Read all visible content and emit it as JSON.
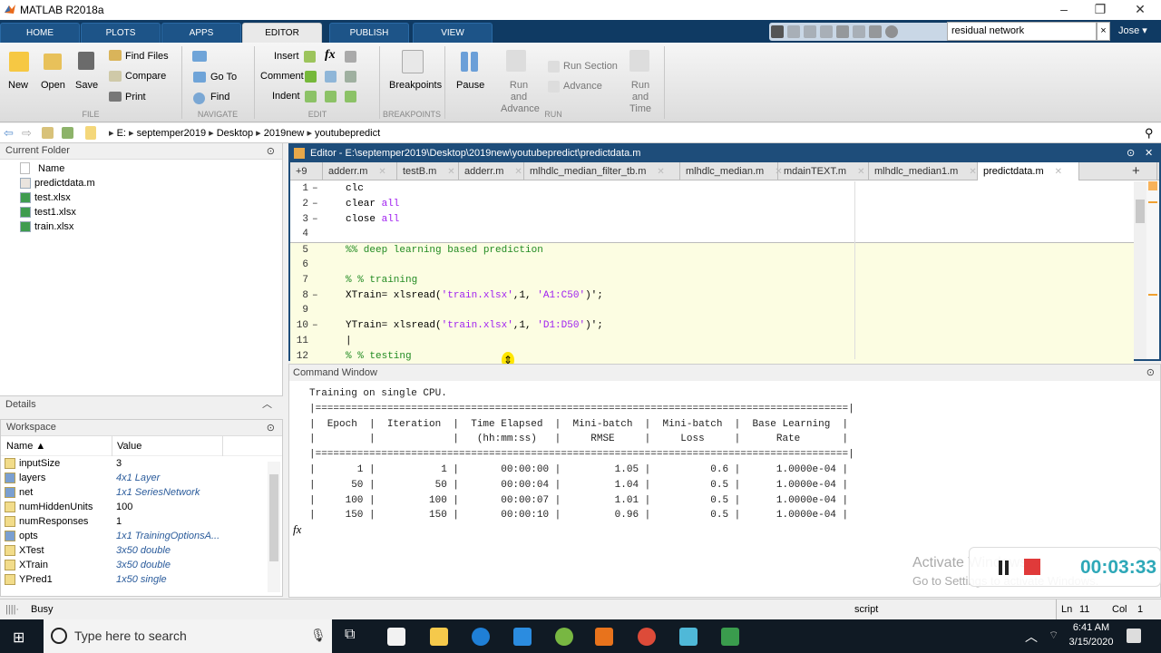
{
  "window": {
    "title": "MATLAB R2018a"
  },
  "ribbon_tabs": [
    "HOME",
    "PLOTS",
    "APPS",
    "EDITOR",
    "PUBLISH",
    "VIEW"
  ],
  "active_tab": "EDITOR",
  "search": {
    "value": "residual network",
    "clear": "×"
  },
  "user": "Jose ▾",
  "ribbon": {
    "file": {
      "new": "New",
      "open": "Open",
      "save": "Save",
      "find_files": "Find Files",
      "compare": "Compare",
      "print": "Print",
      "section": "FILE"
    },
    "navigate": {
      "goto": "Go To",
      "find": "Find",
      "section": "NAVIGATE"
    },
    "edit": {
      "insert": "Insert",
      "comment": "Comment",
      "indent": "Indent",
      "fx": "fx",
      "section": "EDIT"
    },
    "breakpoints": {
      "label": "Breakpoints",
      "section": "BREAKPOINTS"
    },
    "run": {
      "pause": "Pause",
      "run_advance": "Run and Advance",
      "run_section": "Run Section",
      "advance": "Advance",
      "run_time": "Run and Time",
      "section": "RUN"
    }
  },
  "address": {
    "segments": [
      "E:",
      "septemper2019",
      "Desktop",
      "2019new",
      "youtubepredict"
    ]
  },
  "current_folder": {
    "title": "Current Folder",
    "column": "Name",
    "files": [
      {
        "name": "predictdata.m",
        "type": "m"
      },
      {
        "name": "test.xlsx",
        "type": "xlsx"
      },
      {
        "name": "test1.xlsx",
        "type": "xlsx"
      },
      {
        "name": "train.xlsx",
        "type": "xlsx"
      }
    ]
  },
  "details": {
    "title": "Details"
  },
  "workspace": {
    "title": "Workspace",
    "columns": [
      "Name ▲",
      "Value"
    ],
    "vars": [
      {
        "name": "inputSize",
        "value": "3",
        "kind": "num"
      },
      {
        "name": "layers",
        "value": "4x1 Layer",
        "kind": "obj"
      },
      {
        "name": "net",
        "value": "1x1 SeriesNetwork",
        "kind": "obj"
      },
      {
        "name": "numHiddenUnits",
        "value": "100",
        "kind": "num"
      },
      {
        "name": "numResponses",
        "value": "1",
        "kind": "num"
      },
      {
        "name": "opts",
        "value": "1x1 TrainingOptionsA...",
        "kind": "obj"
      },
      {
        "name": "XTest",
        "value": "3x50 double",
        "kind": "arr"
      },
      {
        "name": "XTrain",
        "value": "3x50 double",
        "kind": "arr"
      },
      {
        "name": "YPred1",
        "value": "1x50 single",
        "kind": "arr"
      }
    ]
  },
  "editor": {
    "title": "Editor - E:\\septemper2019\\Desktop\\2019new\\youtubepredict\\predictdata.m",
    "overflow": "+9",
    "tabs": [
      "adderr.m",
      "testB.m",
      "adderr.m",
      "mlhdlc_median_filter_tb.m",
      "mlhdlc_median.m",
      "mdainTEXT.m",
      "mlhdlc_median1.m",
      "predictdata.m"
    ],
    "active_tab": "predictdata.m",
    "lines": [
      {
        "n": "1",
        "dash": "–",
        "html": "clc"
      },
      {
        "n": "2",
        "dash": "–",
        "html": "clear <span class='kw'>all</span>"
      },
      {
        "n": "3",
        "dash": "–",
        "html": "close <span class='kw'>all</span>"
      },
      {
        "n": "4",
        "dash": "",
        "html": ""
      },
      {
        "n": "5",
        "dash": "",
        "html": "<span class='cm'>%% deep learning based prediction</span>"
      },
      {
        "n": "6",
        "dash": "",
        "html": ""
      },
      {
        "n": "7",
        "dash": "",
        "html": "<span class='cm'>% % training</span>"
      },
      {
        "n": "8",
        "dash": "–",
        "html": "XTrain= xlsread(<span class='str'>'train.xlsx'</span>,1, <span class='str'>'A1:C50'</span>)';"
      },
      {
        "n": "9",
        "dash": "",
        "html": ""
      },
      {
        "n": "10",
        "dash": "–",
        "html": "YTrain= xlsread(<span class='str'>'train.xlsx'</span>,1, <span class='str'>'D1:D50'</span>)';"
      },
      {
        "n": "11",
        "dash": "",
        "html": "|"
      },
      {
        "n": "12",
        "dash": "",
        "html": "<span class='cm'>% % testing</span>"
      }
    ]
  },
  "command_window": {
    "title": "Command Window",
    "text": "Training on single CPU.\n|=========================================================================================|\n|  Epoch  |  Iteration  |  Time Elapsed  |  Mini-batch  |  Mini-batch  |  Base Learning  |\n|         |             |   (hh:mm:ss)   |     RMSE     |     Loss     |      Rate       |\n|=========================================================================================|\n|       1 |           1 |       00:00:00 |         1.05 |          0.6 |      1.0000e-04 |\n|      50 |          50 |       00:00:04 |         1.04 |          0.5 |      1.0000e-04 |\n|     100 |         100 |       00:00:07 |         1.01 |          0.5 |      1.0000e-04 |\n|     150 |         150 |       00:00:10 |         0.96 |          0.5 |      1.0000e-04 |",
    "prompt": "fx"
  },
  "status": {
    "state": "Busy",
    "mode": "script",
    "ln_label": "Ln",
    "ln": "11",
    "col_label": "Col",
    "col": "1"
  },
  "recorder": {
    "time": "00:03:33",
    "time_color": "#2ea8b8"
  },
  "watermark": {
    "line1": "Activate Windows",
    "line2": "Go to Settings to activate Windows."
  },
  "taskbar": {
    "search_placeholder": "Type here to search",
    "time": "6:41 AM",
    "date": "3/15/2020"
  }
}
